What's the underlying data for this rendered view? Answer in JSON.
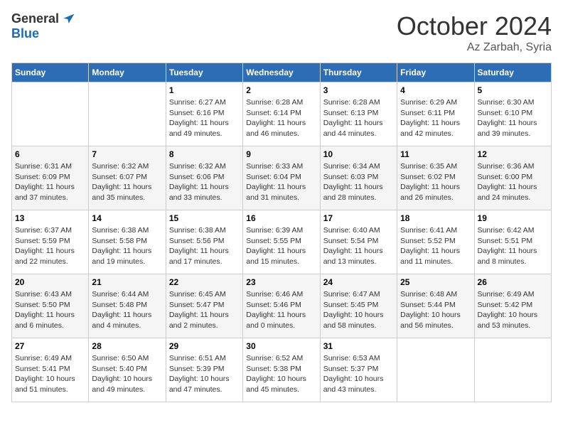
{
  "header": {
    "logo_general": "General",
    "logo_blue": "Blue",
    "title": "October 2024",
    "location": "Az Zarbah, Syria"
  },
  "weekdays": [
    "Sunday",
    "Monday",
    "Tuesday",
    "Wednesday",
    "Thursday",
    "Friday",
    "Saturday"
  ],
  "weeks": [
    [
      {
        "day": "",
        "text": ""
      },
      {
        "day": "",
        "text": ""
      },
      {
        "day": "1",
        "text": "Sunrise: 6:27 AM\nSunset: 6:16 PM\nDaylight: 11 hours and 49 minutes."
      },
      {
        "day": "2",
        "text": "Sunrise: 6:28 AM\nSunset: 6:14 PM\nDaylight: 11 hours and 46 minutes."
      },
      {
        "day": "3",
        "text": "Sunrise: 6:28 AM\nSunset: 6:13 PM\nDaylight: 11 hours and 44 minutes."
      },
      {
        "day": "4",
        "text": "Sunrise: 6:29 AM\nSunset: 6:11 PM\nDaylight: 11 hours and 42 minutes."
      },
      {
        "day": "5",
        "text": "Sunrise: 6:30 AM\nSunset: 6:10 PM\nDaylight: 11 hours and 39 minutes."
      }
    ],
    [
      {
        "day": "6",
        "text": "Sunrise: 6:31 AM\nSunset: 6:09 PM\nDaylight: 11 hours and 37 minutes."
      },
      {
        "day": "7",
        "text": "Sunrise: 6:32 AM\nSunset: 6:07 PM\nDaylight: 11 hours and 35 minutes."
      },
      {
        "day": "8",
        "text": "Sunrise: 6:32 AM\nSunset: 6:06 PM\nDaylight: 11 hours and 33 minutes."
      },
      {
        "day": "9",
        "text": "Sunrise: 6:33 AM\nSunset: 6:04 PM\nDaylight: 11 hours and 31 minutes."
      },
      {
        "day": "10",
        "text": "Sunrise: 6:34 AM\nSunset: 6:03 PM\nDaylight: 11 hours and 28 minutes."
      },
      {
        "day": "11",
        "text": "Sunrise: 6:35 AM\nSunset: 6:02 PM\nDaylight: 11 hours and 26 minutes."
      },
      {
        "day": "12",
        "text": "Sunrise: 6:36 AM\nSunset: 6:00 PM\nDaylight: 11 hours and 24 minutes."
      }
    ],
    [
      {
        "day": "13",
        "text": "Sunrise: 6:37 AM\nSunset: 5:59 PM\nDaylight: 11 hours and 22 minutes."
      },
      {
        "day": "14",
        "text": "Sunrise: 6:38 AM\nSunset: 5:58 PM\nDaylight: 11 hours and 19 minutes."
      },
      {
        "day": "15",
        "text": "Sunrise: 6:38 AM\nSunset: 5:56 PM\nDaylight: 11 hours and 17 minutes."
      },
      {
        "day": "16",
        "text": "Sunrise: 6:39 AM\nSunset: 5:55 PM\nDaylight: 11 hours and 15 minutes."
      },
      {
        "day": "17",
        "text": "Sunrise: 6:40 AM\nSunset: 5:54 PM\nDaylight: 11 hours and 13 minutes."
      },
      {
        "day": "18",
        "text": "Sunrise: 6:41 AM\nSunset: 5:52 PM\nDaylight: 11 hours and 11 minutes."
      },
      {
        "day": "19",
        "text": "Sunrise: 6:42 AM\nSunset: 5:51 PM\nDaylight: 11 hours and 8 minutes."
      }
    ],
    [
      {
        "day": "20",
        "text": "Sunrise: 6:43 AM\nSunset: 5:50 PM\nDaylight: 11 hours and 6 minutes."
      },
      {
        "day": "21",
        "text": "Sunrise: 6:44 AM\nSunset: 5:48 PM\nDaylight: 11 hours and 4 minutes."
      },
      {
        "day": "22",
        "text": "Sunrise: 6:45 AM\nSunset: 5:47 PM\nDaylight: 11 hours and 2 minutes."
      },
      {
        "day": "23",
        "text": "Sunrise: 6:46 AM\nSunset: 5:46 PM\nDaylight: 11 hours and 0 minutes."
      },
      {
        "day": "24",
        "text": "Sunrise: 6:47 AM\nSunset: 5:45 PM\nDaylight: 10 hours and 58 minutes."
      },
      {
        "day": "25",
        "text": "Sunrise: 6:48 AM\nSunset: 5:44 PM\nDaylight: 10 hours and 56 minutes."
      },
      {
        "day": "26",
        "text": "Sunrise: 6:49 AM\nSunset: 5:42 PM\nDaylight: 10 hours and 53 minutes."
      }
    ],
    [
      {
        "day": "27",
        "text": "Sunrise: 6:49 AM\nSunset: 5:41 PM\nDaylight: 10 hours and 51 minutes."
      },
      {
        "day": "28",
        "text": "Sunrise: 6:50 AM\nSunset: 5:40 PM\nDaylight: 10 hours and 49 minutes."
      },
      {
        "day": "29",
        "text": "Sunrise: 6:51 AM\nSunset: 5:39 PM\nDaylight: 10 hours and 47 minutes."
      },
      {
        "day": "30",
        "text": "Sunrise: 6:52 AM\nSunset: 5:38 PM\nDaylight: 10 hours and 45 minutes."
      },
      {
        "day": "31",
        "text": "Sunrise: 6:53 AM\nSunset: 5:37 PM\nDaylight: 10 hours and 43 minutes."
      },
      {
        "day": "",
        "text": ""
      },
      {
        "day": "",
        "text": ""
      }
    ]
  ]
}
